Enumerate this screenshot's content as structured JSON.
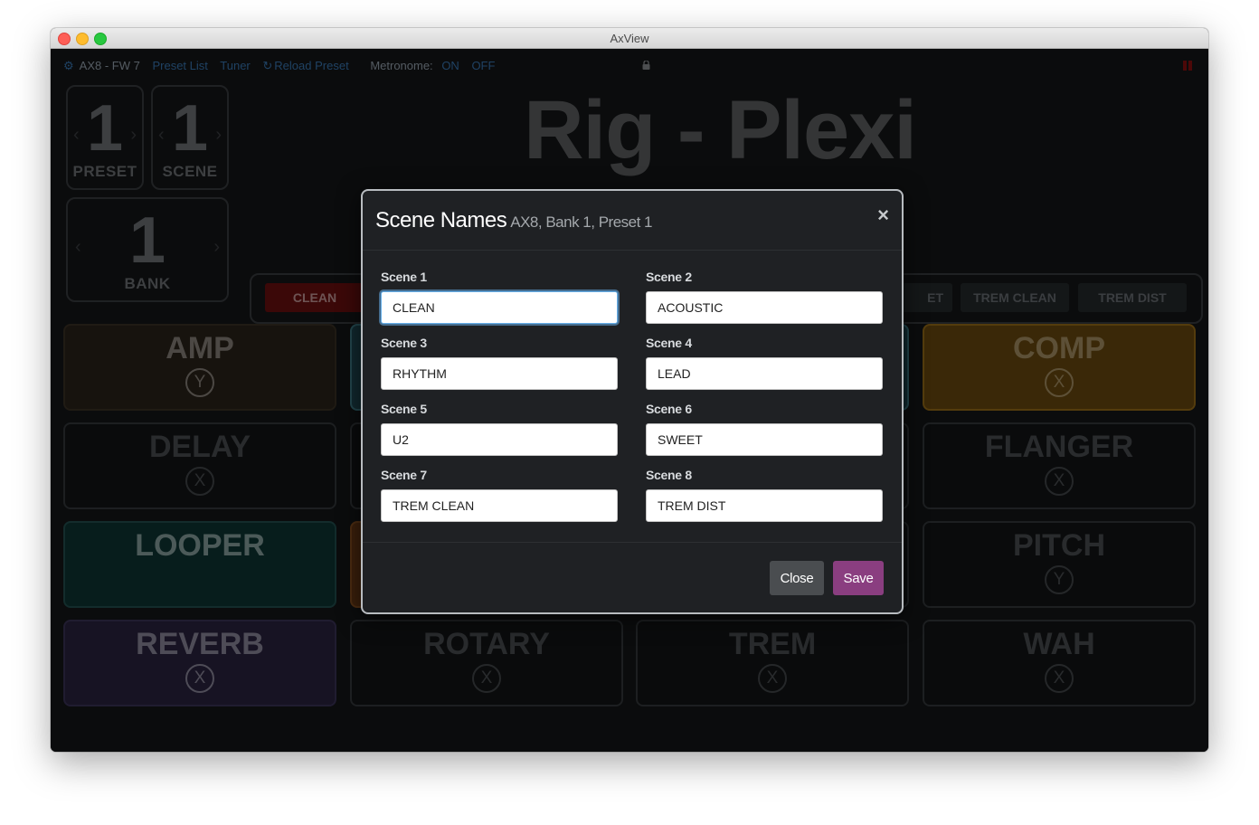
{
  "window": {
    "title": "AxView"
  },
  "nav": {
    "device": "AX8 - FW 7",
    "preset_list": "Preset List",
    "tuner": "Tuner",
    "reload_preset": "Reload Preset",
    "metronome_label": "Metronome:",
    "metronome_on": "ON",
    "metronome_off": "OFF"
  },
  "counters": {
    "preset": {
      "value": "1",
      "label": "PRESET"
    },
    "scene": {
      "value": "1",
      "label": "SCENE"
    },
    "bank": {
      "value": "1",
      "label": "BANK"
    }
  },
  "rig_title": "Rig - Plexi",
  "scene_bar": {
    "visible": [
      {
        "label": "CLEAN",
        "active": true
      },
      {
        "label": "ET",
        "active": false
      },
      {
        "label": "TREM CLEAN",
        "active": false
      },
      {
        "label": "TREM DIST",
        "active": false
      }
    ]
  },
  "effects": [
    {
      "name": "AMP",
      "badge": "Y"
    },
    {
      "name": "COMP",
      "badge": "X"
    },
    {
      "name": "DELAY",
      "badge": "X"
    },
    {
      "name": "FLANGER",
      "badge": "X"
    },
    {
      "name": "LOOPER",
      "badge": ""
    },
    {
      "name": "PITCH",
      "badge": "Y"
    },
    {
      "name": "REVERB",
      "badge": "X"
    },
    {
      "name": "ROTARY",
      "badge": "X"
    },
    {
      "name": "TREM",
      "badge": "X"
    },
    {
      "name": "WAH",
      "badge": "X"
    }
  ],
  "modal": {
    "title": "Scene Names",
    "subtitle": "AX8, Bank 1, Preset 1",
    "close_glyph": "×",
    "fields": [
      {
        "label": "Scene 1",
        "value": "CLEAN"
      },
      {
        "label": "Scene 2",
        "value": "ACOUSTIC"
      },
      {
        "label": "Scene 3",
        "value": "RHYTHM"
      },
      {
        "label": "Scene 4",
        "value": "LEAD"
      },
      {
        "label": "Scene 5",
        "value": "U2"
      },
      {
        "label": "Scene 6",
        "value": "SWEET"
      },
      {
        "label": "Scene 7",
        "value": "TREM CLEAN"
      },
      {
        "label": "Scene 8",
        "value": "TREM DIST"
      }
    ],
    "buttons": {
      "close": "Close",
      "save": "Save"
    }
  },
  "colors": {
    "accent": "#8a3e80",
    "link": "#3a78b5",
    "active_scene": "#6c0f0f"
  }
}
